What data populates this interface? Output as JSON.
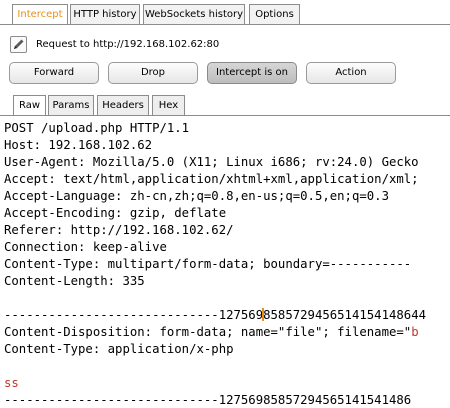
{
  "top_tabs": [
    "Intercept",
    "HTTP history",
    "WebSockets history",
    "Options"
  ],
  "request_label": "Request to http://192.168.102.62:80",
  "buttons": {
    "forward": "Forward",
    "drop": "Drop",
    "intercept": "Intercept is on",
    "action": "Action"
  },
  "sub_tabs": [
    "Raw",
    "Params",
    "Headers",
    "Hex"
  ],
  "request_lines": [
    "POST /upload.php HTTP/1.1",
    "Host: 192.168.102.62",
    "User-Agent: Mozilla/5.0 (X11; Linux i686; rv:24.0) Gecko",
    "Accept: text/html,application/xhtml+xml,application/xml;",
    "Accept-Language: zh-cn,zh;q=0.8,en-us;q=0.5,en;q=0.3",
    "Accept-Encoding: gzip, deflate",
    "Referer: http://192.168.102.62/",
    "Connection: keep-alive",
    "Content-Type: multipart/form-data; boundary=-----------",
    "Content-Length: 335"
  ],
  "boundary_line_1": {
    "before_caret": "-----------------------------127569",
    "after_caret": "8585729456514154148644"
  },
  "disposition_line": {
    "text": "Content-Disposition: form-data; name=\"file\"; filename=\"",
    "highlight": "b"
  },
  "content_type_line": "Content-Type: application/x-php",
  "body_line": "ss",
  "boundary_line_2": "-----------------------------12756985857294565141541486"
}
